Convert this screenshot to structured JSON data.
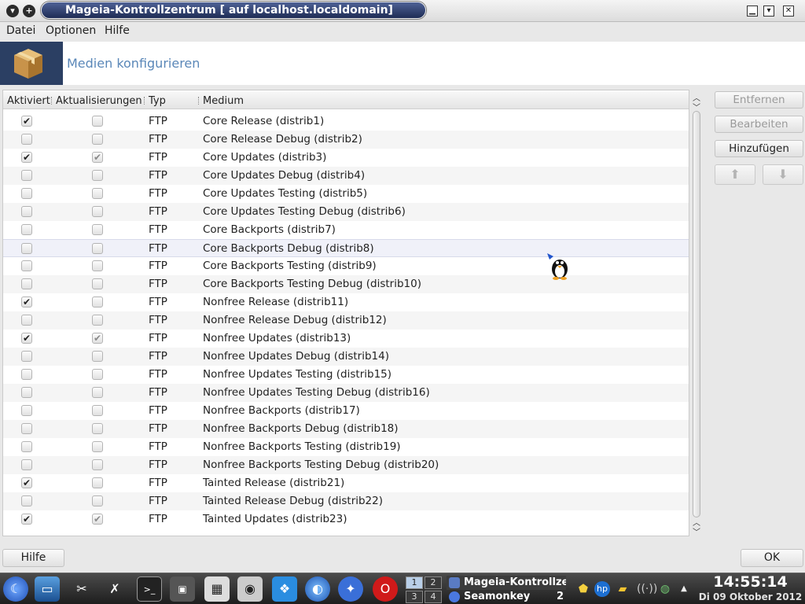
{
  "window": {
    "title": "Mageia-Kontrollzentrum  [ auf localhost.localdomain]"
  },
  "menu": [
    "Datei",
    "Optionen",
    "Hilfe"
  ],
  "header": {
    "title": "Medien konfigurieren"
  },
  "columns": [
    "Aktiviert",
    "Aktualisierungen",
    "Typ",
    "Medium"
  ],
  "rows": [
    {
      "enabled": true,
      "update": false,
      "type": "FTP",
      "medium": "Core Release (distrib1)"
    },
    {
      "enabled": false,
      "update": false,
      "type": "FTP",
      "medium": "Core Release Debug (distrib2)"
    },
    {
      "enabled": true,
      "update": true,
      "type": "FTP",
      "medium": "Core Updates (distrib3)"
    },
    {
      "enabled": false,
      "update": false,
      "type": "FTP",
      "medium": "Core Updates Debug (distrib4)"
    },
    {
      "enabled": false,
      "update": false,
      "type": "FTP",
      "medium": "Core Updates Testing (distrib5)"
    },
    {
      "enabled": false,
      "update": false,
      "type": "FTP",
      "medium": "Core Updates Testing Debug (distrib6)"
    },
    {
      "enabled": false,
      "update": false,
      "type": "FTP",
      "medium": "Core Backports (distrib7)"
    },
    {
      "enabled": false,
      "update": false,
      "type": "FTP",
      "medium": "Core Backports Debug (distrib8)",
      "selected": true
    },
    {
      "enabled": false,
      "update": false,
      "type": "FTP",
      "medium": "Core Backports Testing (distrib9)"
    },
    {
      "enabled": false,
      "update": false,
      "type": "FTP",
      "medium": "Core Backports Testing Debug (distrib10)"
    },
    {
      "enabled": true,
      "update": false,
      "type": "FTP",
      "medium": "Nonfree Release (distrib11)"
    },
    {
      "enabled": false,
      "update": false,
      "type": "FTP",
      "medium": "Nonfree Release Debug (distrib12)"
    },
    {
      "enabled": true,
      "update": true,
      "type": "FTP",
      "medium": "Nonfree Updates (distrib13)"
    },
    {
      "enabled": false,
      "update": false,
      "type": "FTP",
      "medium": "Nonfree Updates Debug (distrib14)"
    },
    {
      "enabled": false,
      "update": false,
      "type": "FTP",
      "medium": "Nonfree Updates Testing (distrib15)"
    },
    {
      "enabled": false,
      "update": false,
      "type": "FTP",
      "medium": "Nonfree Updates Testing Debug (distrib16)"
    },
    {
      "enabled": false,
      "update": false,
      "type": "FTP",
      "medium": "Nonfree Backports (distrib17)"
    },
    {
      "enabled": false,
      "update": false,
      "type": "FTP",
      "medium": "Nonfree Backports Debug (distrib18)"
    },
    {
      "enabled": false,
      "update": false,
      "type": "FTP",
      "medium": "Nonfree Backports Testing (distrib19)"
    },
    {
      "enabled": false,
      "update": false,
      "type": "FTP",
      "medium": "Nonfree Backports Testing Debug (distrib20)"
    },
    {
      "enabled": true,
      "update": false,
      "type": "FTP",
      "medium": "Tainted Release (distrib21)"
    },
    {
      "enabled": false,
      "update": false,
      "type": "FTP",
      "medium": "Tainted Release Debug (distrib22)"
    },
    {
      "enabled": true,
      "update": true,
      "type": "FTP",
      "medium": "Tainted Updates (distrib23)"
    }
  ],
  "side_buttons": {
    "remove": "Entfernen",
    "edit": "Bearbeiten",
    "add": "Hinzufügen"
  },
  "bottom": {
    "help": "Hilfe",
    "ok": "OK"
  },
  "taskbar": {
    "pager": [
      "1",
      "2",
      "3",
      "4"
    ],
    "tasks": [
      {
        "label": "Mageia-Kontrollzentrum",
        "count": ""
      },
      {
        "label": "Seamonkey",
        "count": "2"
      }
    ],
    "clock_time": "14:55:14",
    "clock_date": "Di 09 Oktober 2012"
  },
  "colors": {
    "title_accent": "#2f3f6e",
    "header_title": "#5a87b8",
    "taskbar": "#2a2a2a"
  }
}
